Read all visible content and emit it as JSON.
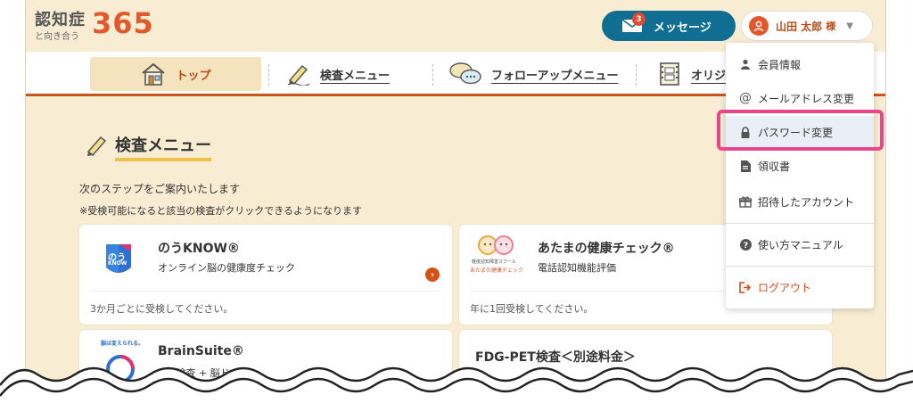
{
  "logo": {
    "main": "認知症",
    "sub": "と向き合う",
    "num": "365"
  },
  "header": {
    "message_label": "メッセージ",
    "message_badge": "3",
    "user_name": "山田 太郎",
    "user_suffix": "様"
  },
  "nav": {
    "items": [
      {
        "label": "トップ",
        "icon": "house-icon"
      },
      {
        "label": "検査メニュー",
        "icon": "pencil-icon"
      },
      {
        "label": "フォローアップメニュー",
        "icon": "speech-bubbles-icon"
      },
      {
        "label": "オリジ",
        "icon": "film-icon"
      }
    ]
  },
  "main": {
    "title": "検査メニュー",
    "intro": "次のステップをご案内いたします",
    "note": "※受検可能になると該当の検査がクリックできるようになります",
    "cards": [
      {
        "title": "のうKNOW®",
        "subtitle": "オンライン脳の健康度チェック",
        "footer": "3か月ごとに受検してください。",
        "logo_text_1": "のう",
        "logo_text_2": "KNOW"
      },
      {
        "title": "あたまの健康チェック®",
        "subtitle": "電話認知機能評価",
        "footer": "年に1回受検してください。",
        "logo_text": "あたまの健康チェック",
        "logo_small": "軽度認知障害スクール"
      },
      {
        "title": "BrainSuite®",
        "subtitle": "MRI検査 + 脳ドック",
        "logo_text": "脳は変えられる。"
      },
      {
        "title": "FDG-PET検査＜別途料金＞"
      }
    ]
  },
  "dropdown": {
    "items": [
      {
        "label": "会員情報",
        "icon": "person-icon"
      },
      {
        "label": "メールアドレス変更",
        "icon": "at-icon"
      },
      {
        "label": "パスワード変更",
        "icon": "lock-icon"
      },
      {
        "label": "領収書",
        "icon": "document-icon"
      },
      {
        "label": "招待したアカウント",
        "icon": "gift-icon"
      },
      {
        "label": "使い方マニュアル",
        "icon": "question-icon"
      },
      {
        "label": "ログアウト",
        "icon": "logout-icon"
      }
    ]
  },
  "colors": {
    "background": "#f8edd3",
    "accent": "#e2582b",
    "nav_underline": "#c9541c",
    "message_button": "#0f6e91",
    "highlight_border": "#e8458d"
  }
}
